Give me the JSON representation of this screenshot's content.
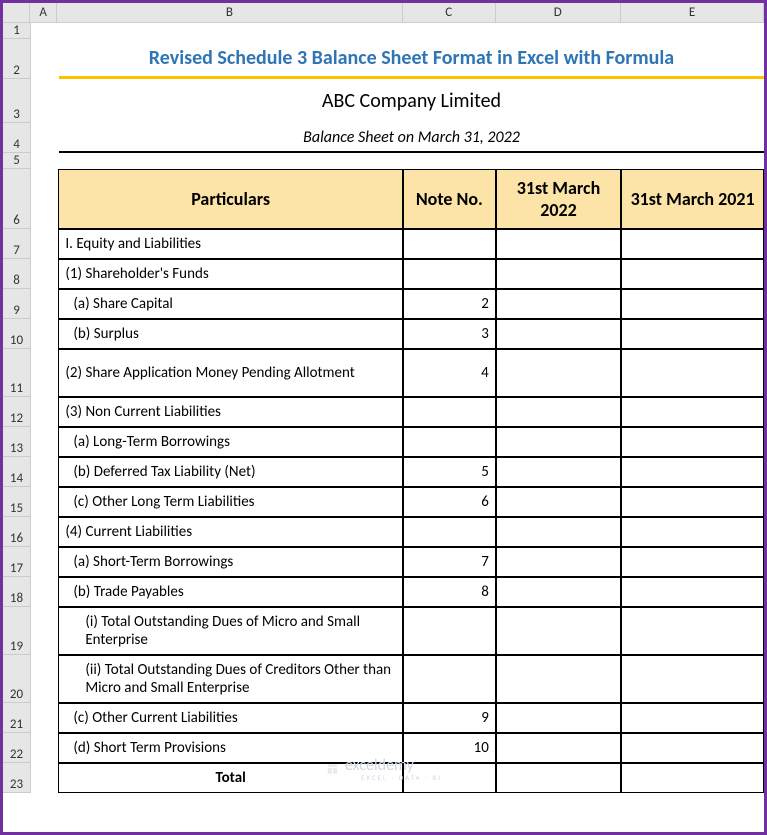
{
  "columns": [
    "A",
    "B",
    "C",
    "D",
    "E"
  ],
  "title": "Revised Schedule 3 Balance Sheet Format in Excel with Formula",
  "company": "ABC Company Limited",
  "subtitle": "Balance Sheet on March 31, 2022",
  "headers": {
    "particulars": "Particulars",
    "note": "Note No.",
    "year1": "31st March 2022",
    "year2": "31st March 2021"
  },
  "rows": [
    {
      "num": 7,
      "label": "I. Equity and Liabilities",
      "note": "",
      "indent": 0
    },
    {
      "num": 8,
      "label": "(1) Shareholder's Funds",
      "note": "",
      "indent": 0
    },
    {
      "num": 9,
      "label": "(a) Share Capital",
      "note": "2",
      "indent": 1
    },
    {
      "num": 10,
      "label": "(b) Surplus",
      "note": "3",
      "indent": 1
    },
    {
      "num": 11,
      "label": "(2) Share Application Money Pending Allotment",
      "note": "4",
      "indent": 0,
      "tall": true
    },
    {
      "num": 12,
      "label": "(3) Non Current Liabilities",
      "note": "",
      "indent": 0
    },
    {
      "num": 13,
      "label": "(a) Long-Term Borrowings",
      "note": "",
      "indent": 1
    },
    {
      "num": 14,
      "label": "(b) Deferred Tax Liability (Net)",
      "note": "5",
      "indent": 1
    },
    {
      "num": 15,
      "label": "(c) Other Long Term Liabilities",
      "note": "6",
      "indent": 1
    },
    {
      "num": 16,
      "label": "(4) Current Liabilities",
      "note": "",
      "indent": 0
    },
    {
      "num": 17,
      "label": "(a) Short-Term Borrowings",
      "note": "7",
      "indent": 1
    },
    {
      "num": 18,
      "label": "(b) Trade Payables",
      "note": "8",
      "indent": 1
    },
    {
      "num": 19,
      "label": "(i) Total Outstanding Dues of Micro and Small Enterprise",
      "note": "",
      "indent": 2,
      "tall": true
    },
    {
      "num": 20,
      "label": "(ii) Total Outstanding Dues of Creditors Other than Micro and Small Enterprise",
      "note": "",
      "indent": 2,
      "tall": true
    },
    {
      "num": 21,
      "label": "(c) Other Current Liabilities",
      "note": "9",
      "indent": 1
    },
    {
      "num": 22,
      "label": "(d) Short Term Provisions",
      "note": "10",
      "indent": 1
    },
    {
      "num": 23,
      "label": "Total",
      "note": "",
      "indent": 0,
      "bold": true,
      "center": true
    }
  ],
  "watermark": {
    "brand": "exceldemy",
    "tag": "EXCEL · DATA · BI"
  }
}
